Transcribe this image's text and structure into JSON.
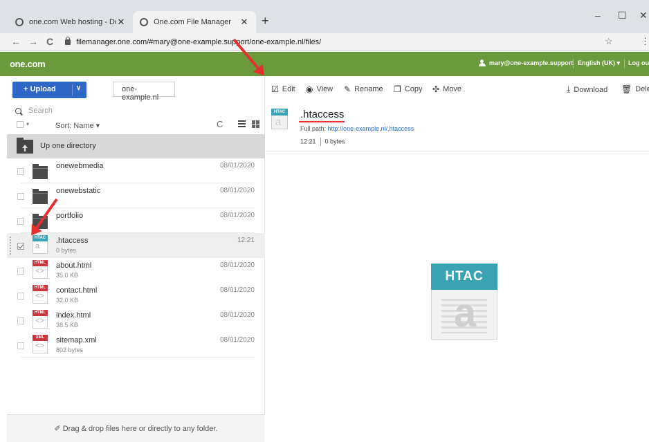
{
  "browser": {
    "tabs": [
      {
        "title": "one.com Web hosting - Domai",
        "active": false
      },
      {
        "title": "One.com File Manager",
        "active": true
      }
    ],
    "url": "filemanager.one.com/#mary@one-example.support/one-example.nl/files/",
    "new_tab": "+",
    "minimize": "–",
    "maximize": "☐",
    "close": "✕",
    "back": "←",
    "forward": "→",
    "reload": "C",
    "star": "☆",
    "menu": "⋮"
  },
  "header": {
    "logo": "one.com",
    "user": "mary@one-example.support",
    "language": "English (UK) ▾",
    "logout": "Log out"
  },
  "left": {
    "upload_label": "+ Upload",
    "upload_caret": "∨",
    "site": "one-example.nl",
    "search_placeholder": "Search",
    "sort_label": "Sort: Name ▾",
    "refresh": "C",
    "select_caret": "▾",
    "up_directory": "Up one directory",
    "folders": [
      {
        "name": "onewebmedia",
        "date": "08/01/2020"
      },
      {
        "name": "onewebstatic",
        "date": "08/01/2020"
      },
      {
        "name": "portfolio",
        "date": "08/01/2020"
      }
    ],
    "files": [
      {
        "name": ".htaccess",
        "size": "0 bytes",
        "date": "12:21",
        "type": "HTAC",
        "color": "#3aa3b3",
        "glyph": "a",
        "selected": true
      },
      {
        "name": "about.html",
        "size": "35.0 KB",
        "date": "08/01/2020",
        "type": "HTML",
        "color": "#c8373e",
        "glyph": "<>",
        "selected": false
      },
      {
        "name": "contact.html",
        "size": "32.0 KB",
        "date": "08/01/2020",
        "type": "HTML",
        "color": "#c8373e",
        "glyph": "<>",
        "selected": false
      },
      {
        "name": "index.html",
        "size": "38.5 KB",
        "date": "08/01/2020",
        "type": "HTML",
        "color": "#c8373e",
        "glyph": "<>",
        "selected": false
      },
      {
        "name": "sitemap.xml",
        "size": "802 bytes",
        "date": "08/01/2020",
        "type": "XML",
        "color": "#c8373e",
        "glyph": "<>",
        "selected": false
      }
    ],
    "dropzone": "✐ Drag & drop files here or directly to any folder."
  },
  "toolbar": {
    "edit": "Edit",
    "view": "View",
    "rename": "Rename",
    "copy": "Copy",
    "move": "Move",
    "download": "Download",
    "delete": "Delete"
  },
  "detail": {
    "icon_type": "HTAC",
    "icon_glyph": "a",
    "filename": ".htaccess",
    "full_path_label": "Full path:",
    "full_path": "http://one-example.nl/.htaccess",
    "time": "12:21",
    "size": "0 bytes"
  },
  "colors": {
    "brand_green": "#6a9a3b",
    "upload_blue": "#2f67c7",
    "htac_teal": "#3aa3b3",
    "html_red": "#c8373e",
    "annotation_red": "#e53030"
  }
}
